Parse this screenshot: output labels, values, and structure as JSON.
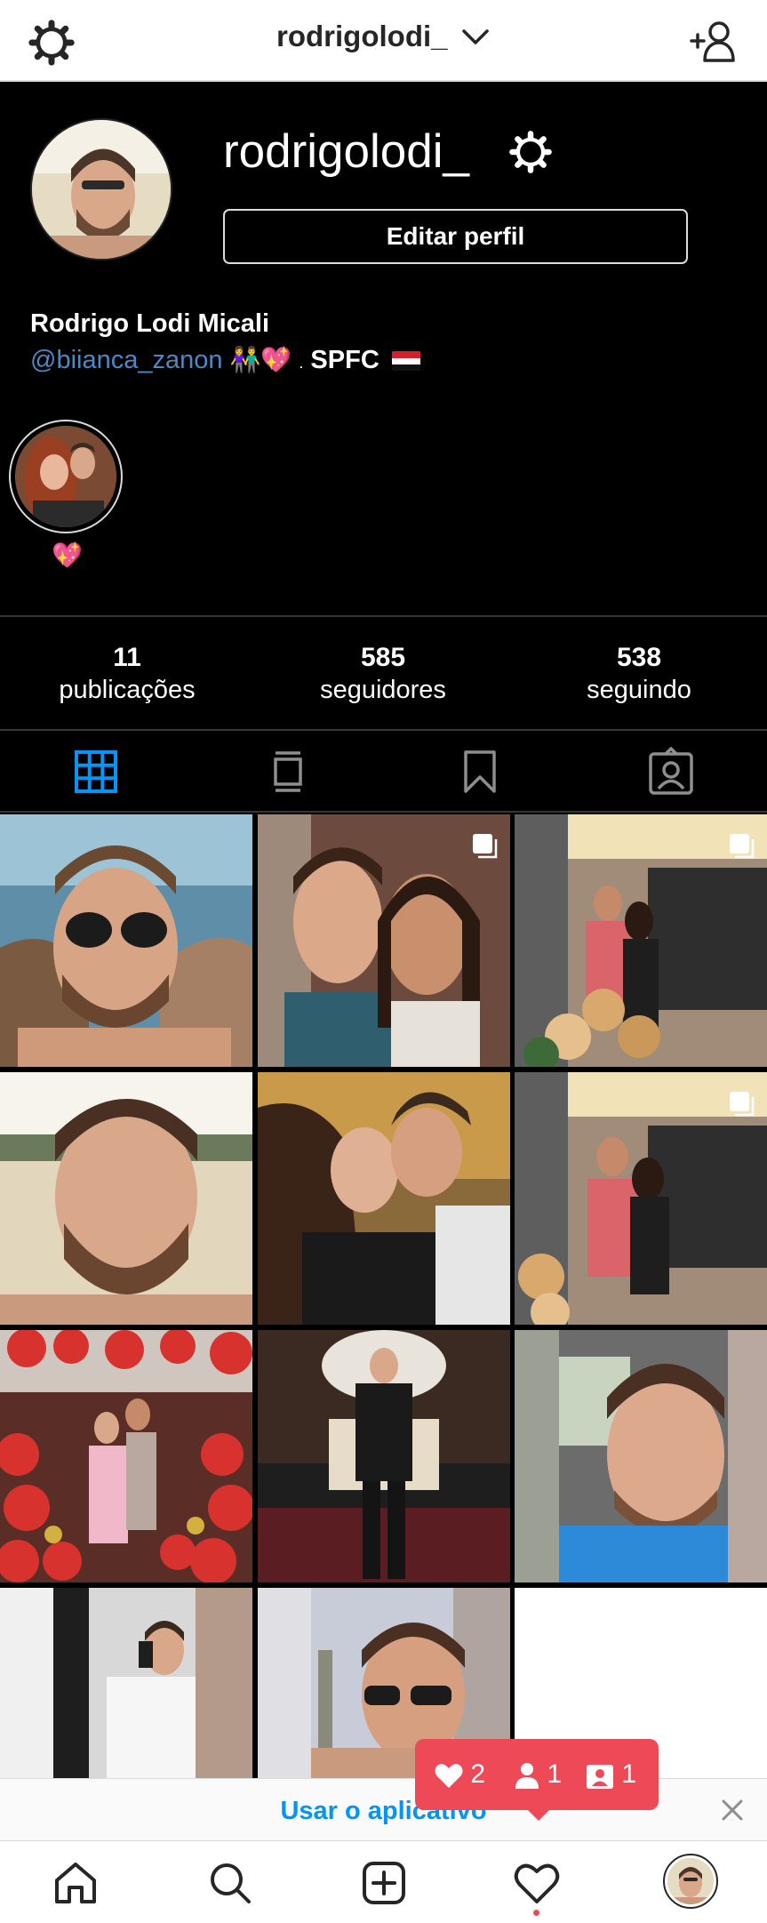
{
  "topbar": {
    "username": "rodrigolodi_",
    "icons": {
      "left": "settings-gear-icon",
      "title_dropdown": "chevron-down-icon",
      "right": "add-person-icon"
    }
  },
  "profile": {
    "username": "rodrigolodi_",
    "edit_button": "Editar perfil",
    "full_name": "Rodrigo Lodi Micali",
    "bio": {
      "mention": "@biianca_zanon",
      "emojis": "👫💖",
      "dot": ".",
      "team": "SPFC",
      "flag_colors": [
        "#d62027",
        "#ffffff",
        "#111111"
      ]
    }
  },
  "highlight": {
    "label": "💖"
  },
  "stats": [
    {
      "value": "11",
      "label": "publicações"
    },
    {
      "value": "585",
      "label": "seguidores"
    },
    {
      "value": "538",
      "label": "seguindo"
    }
  ],
  "tabs": [
    "grid-icon",
    "igtv-icon",
    "saved-bookmark-icon",
    "tagged-icon"
  ],
  "colors": {
    "accent": "#0095f6",
    "notification": "#ed4956",
    "background": "#000000"
  },
  "posts": [
    {
      "name": "post-beach-sunglasses",
      "multi": false
    },
    {
      "name": "post-couple-selfie",
      "multi": true
    },
    {
      "name": "post-couple-mirror",
      "multi": true
    },
    {
      "name": "post-beach-selfie",
      "multi": false
    },
    {
      "name": "post-couple-sunset",
      "multi": false
    },
    {
      "name": "post-couple-mirror-2",
      "multi": true
    },
    {
      "name": "post-balloons-party",
      "multi": false
    },
    {
      "name": "post-formal-suit",
      "multi": false
    },
    {
      "name": "post-car-selfie",
      "multi": false
    },
    {
      "name": "post-mirror-phone",
      "multi": false
    },
    {
      "name": "post-sunglasses-statue",
      "multi": false
    }
  ],
  "app_banner": {
    "text": "Usar o aplicativo"
  },
  "notification": {
    "likes": "2",
    "followers": "1",
    "tags": "1"
  },
  "bottom_nav": [
    "home-icon",
    "search-icon",
    "new-post-icon",
    "activity-heart-icon",
    "profile-avatar"
  ]
}
